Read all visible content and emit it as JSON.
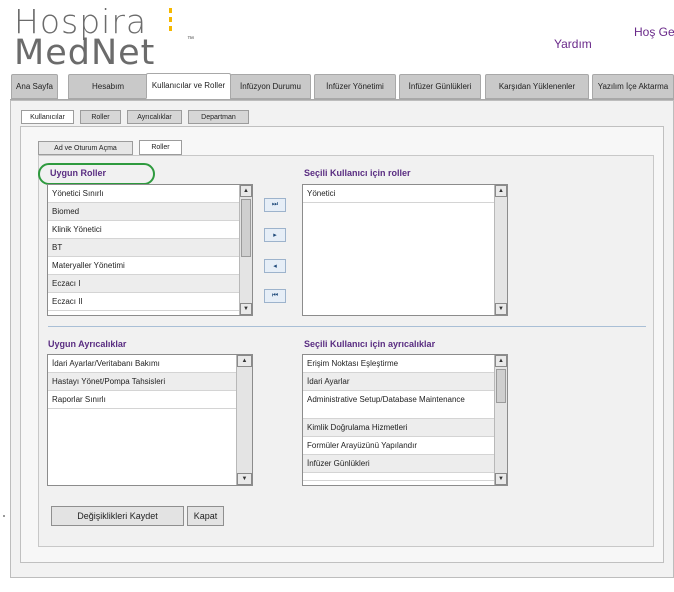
{
  "brand": {
    "line1": "Hospira",
    "line2": "MedNet",
    "tm": "™"
  },
  "header": {
    "help": "Yardım",
    "greeting": "Hoş Gel"
  },
  "nav": {
    "tabs": [
      {
        "label": "Ana Sayfa"
      },
      {
        "label": "Hesabım"
      },
      {
        "label": "Kullanıcılar ve Roller"
      },
      {
        "label": "İnfüzyon Durumu"
      },
      {
        "label": "İnfüzer Yönetimi"
      },
      {
        "label": "İnfüzer Günlükleri"
      },
      {
        "label": "Karşıdan Yüklenenler"
      },
      {
        "label": "Yazılım İçe Aktarma"
      }
    ]
  },
  "subtabs": [
    {
      "label": "Kullanıcılar"
    },
    {
      "label": "Roller"
    },
    {
      "label": "Ayrıcalıklar"
    },
    {
      "label": "Departman"
    }
  ],
  "innertabs": [
    {
      "label": "Ad ve Oturum Açma"
    },
    {
      "label": "Roller"
    }
  ],
  "roles": {
    "available_title": "Uygun Roller",
    "available": [
      "Yönetici Sınırlı",
      "Biomed",
      "Klinik Yönetici",
      "BT",
      "Materyaller Yönetimi",
      "Eczacı I",
      "Eczacı II"
    ],
    "selected_title": "Seçili Kullanıcı için roller",
    "selected": [
      "Yönetici"
    ]
  },
  "move_buttons": [
    "⏭",
    "▸",
    "◂",
    "⏮"
  ],
  "privileges": {
    "available_title": "Uygun Ayrıcalıklar",
    "available": [
      "İdari Ayarlar/Veritabanı Bakımı",
      "Hastayı Yönet/Pompa Tahsisleri",
      "Raporlar Sınırlı"
    ],
    "selected_title": "Seçili Kullanıcı için ayrıcalıklar",
    "selected": [
      "Erişim Noktası Eşleştirme",
      "İdari Ayarlar",
      "Administrative Setup/Database Maintenance",
      "Kimlik Doğrulama Hizmetleri",
      "Formüler Arayüzünü Yapılandır",
      "İnfüzer Günlükleri"
    ]
  },
  "buttons": {
    "save": "Değişiklikleri Kaydet",
    "close": "Kapat"
  },
  "colors": {
    "accent": "#5a2d82",
    "highlight": "#2e9a3e",
    "logo_bar": "#f5b800"
  }
}
